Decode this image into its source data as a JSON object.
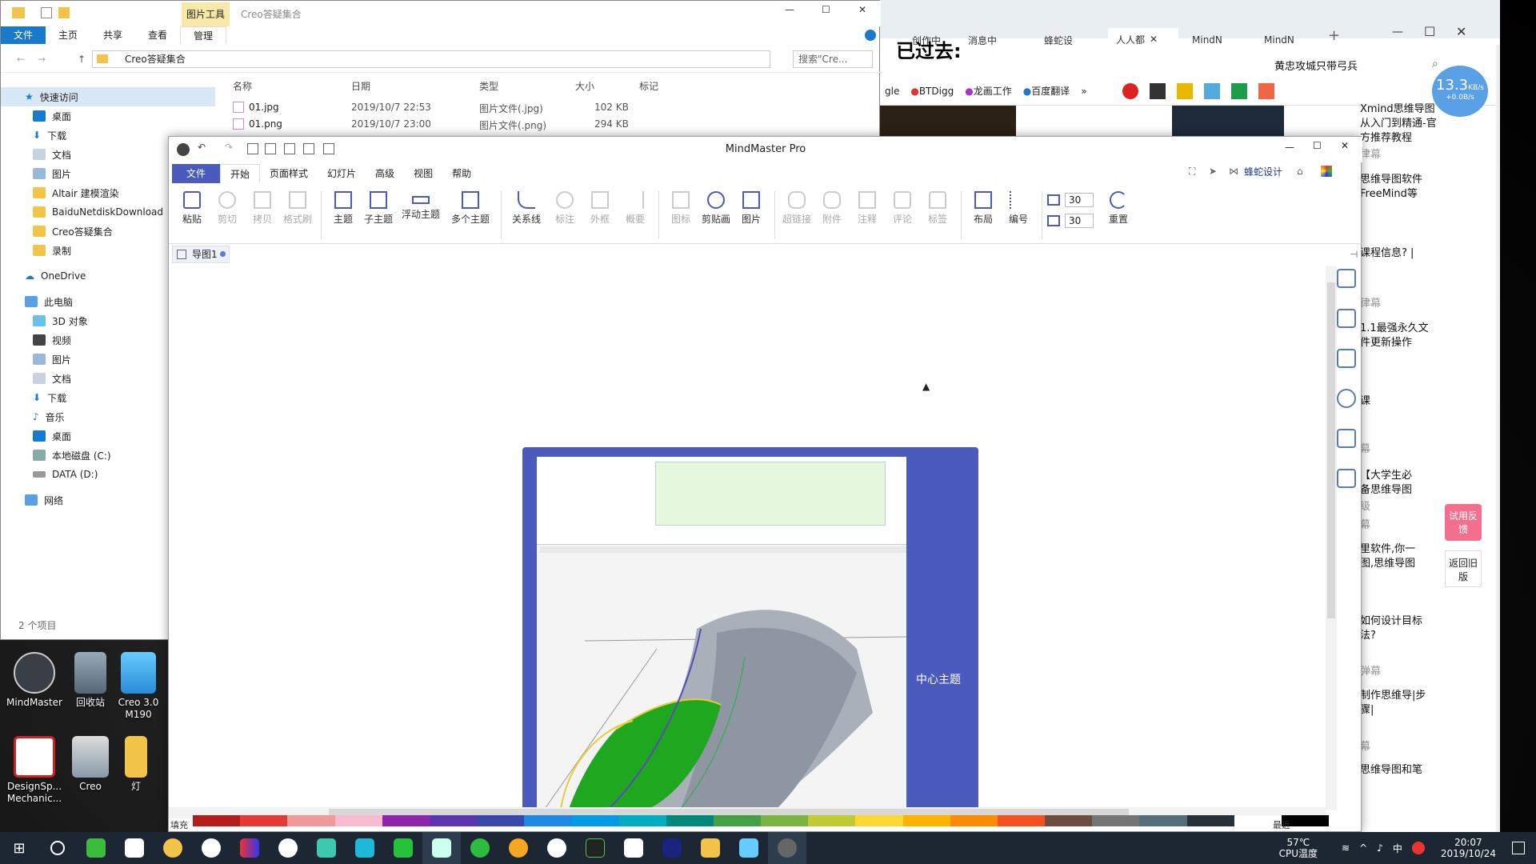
{
  "browser": {
    "tabs": [
      "创作中",
      "消息中",
      "蜂蛇设",
      "人人都",
      "MindN",
      "MindN"
    ],
    "overlay_text": "已过去:",
    "address_right": "黄忠攻城只带弓兵",
    "bookmarks": [
      "gle",
      "BTDigg",
      "龙画工作",
      "百度翻译",
      "»"
    ],
    "speed_value": "13.3",
    "speed_unit": "KB/s",
    "speed_sub": "+0.0B/s",
    "side_texts": [
      "Xmind思维导图从入门到精通-官方推荐教程",
      "律幕",
      "思维导图软件FreeMind等",
      "课程信息? |",
      "律幕",
      "1.1最强永久文件更新操作",
      "课",
      "幕",
      "【大学生必备思维导图",
      "级",
      "幕",
      "里软件,你一图,思维导图",
      "如何设计目标法?",
      "弹幕",
      "制作思维导|步骤|",
      "幕",
      "思维导图和笔"
    ],
    "feedback_label": "试用反馈",
    "return_label": "返回旧版"
  },
  "explorer": {
    "title": "Creo答疑集合",
    "tool_tab": "图片工具",
    "manage_tab": "管理",
    "ribbon_tabs": [
      "文件",
      "主页",
      "共享",
      "查看"
    ],
    "path": "Creo答疑集合",
    "search_placeholder": "搜索\"Cre...",
    "columns": [
      "名称",
      "日期",
      "类型",
      "大小",
      "标记"
    ],
    "files": [
      {
        "name": "01.jpg",
        "date": "2019/10/7 22:53",
        "type": "图片文件(.jpg)",
        "size": "102 KB"
      },
      {
        "name": "01.png",
        "date": "2019/10/7 23:00",
        "type": "图片文件(.png)",
        "size": "294 KB"
      }
    ],
    "nav": {
      "quick_access": "快速访问",
      "quick_items": [
        "桌面",
        "下载",
        "文档",
        "图片",
        "Altair 建模渲染",
        "BaiduNetdiskDownload",
        "Creo答疑集合",
        "录制"
      ],
      "onedrive": "OneDrive",
      "this_pc": "此电脑",
      "pc_items": [
        "3D 对象",
        "视频",
        "图片",
        "文档",
        "下载",
        "音乐",
        "桌面",
        "本地磁盘 (C:)",
        "DATA (D:)"
      ],
      "network": "网络"
    },
    "status": "2 个项目"
  },
  "mindmaster": {
    "title": "MindMaster Pro",
    "menu": [
      "文件",
      "开始",
      "页面样式",
      "幻灯片",
      "高级",
      "视图",
      "帮助"
    ],
    "tools": [
      "粘贴",
      "剪切",
      "拷贝",
      "格式刷",
      "主题",
      "子主题",
      "浮动主题",
      "多个主题",
      "关系线",
      "标注",
      "外框",
      "概要",
      "图标",
      "剪贴画",
      "图片",
      "超链接",
      "附件",
      "注释",
      "评论",
      "标签",
      "布局",
      "编号",
      "重置"
    ],
    "spacing_h": "30",
    "spacing_v": "30",
    "user_label": "蜂蛇设计",
    "doc_tab": "导图1",
    "center_topic": "中心主题",
    "fill_label": "填充",
    "recent_label": "最近"
  },
  "desktop": {
    "icons": [
      "MindMaster",
      "回收站",
      "Creo 3.0 M190",
      "DesignSp... Mechanic...",
      "Creo",
      "灯"
    ]
  },
  "taskbar": {
    "temp": "57℃",
    "temp_label": "CPU温度",
    "ime": "中",
    "time": "20:07",
    "date": "2019/10/24"
  },
  "colors": {
    "accent": "#2b6cc4",
    "mm_frame": "#4a5bbd",
    "green_part": "#1fa81f",
    "taskbar": "#1c2733"
  }
}
